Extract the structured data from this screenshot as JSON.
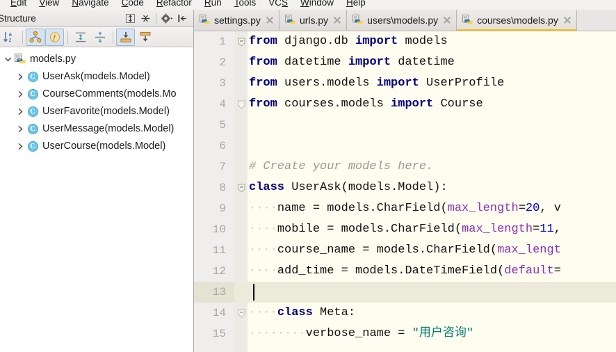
{
  "menu": {
    "items": [
      {
        "label": "Edit",
        "pre": "",
        "mnemonic": "E",
        "rest": "dit"
      },
      {
        "label": "View",
        "pre": "",
        "mnemonic": "V",
        "rest": "iew"
      },
      {
        "label": "Navigate",
        "pre": "",
        "mnemonic": "N",
        "rest": "avigate"
      },
      {
        "label": "Code",
        "pre": "",
        "mnemonic": "C",
        "rest": "ode"
      },
      {
        "label": "Refactor",
        "pre": "",
        "mnemonic": "R",
        "rest": "efactor"
      },
      {
        "label": "Run",
        "pre": "",
        "mnemonic": "R",
        "rest": "un"
      },
      {
        "label": "Tools",
        "pre": "",
        "mnemonic": "T",
        "rest": "ools"
      },
      {
        "label": "VCS",
        "pre": "VC",
        "mnemonic": "S",
        "rest": ""
      },
      {
        "label": "Window",
        "pre": "",
        "mnemonic": "W",
        "rest": "indow"
      },
      {
        "label": "Help",
        "pre": "",
        "mnemonic": "H",
        "rest": "elp"
      }
    ]
  },
  "structure": {
    "title": "Structure",
    "header_actions": [
      "expand-all-icon",
      "collapse-all-icon",
      "gear-icon",
      "hide-panel-icon"
    ],
    "toolbar_buttons": [
      {
        "name": "sort-alphabetically-icon",
        "pressed": false
      },
      {
        "name": "show-inherited-members-icon",
        "pressed": true
      },
      {
        "name": "show-fields-icon",
        "pressed": true
      },
      {
        "name": "expand-all-tree-icon",
        "pressed": false
      },
      {
        "name": "collapse-all-tree-icon",
        "pressed": false
      },
      {
        "name": "autoscroll-to-source-icon",
        "pressed": true
      },
      {
        "name": "autoscroll-from-source-icon",
        "pressed": false
      }
    ],
    "tree": [
      {
        "label": "models.py",
        "icon": "python-file-icon",
        "expanded": true,
        "depth": 0
      },
      {
        "label": "UserAsk(models.Model)",
        "icon": "class-icon",
        "expanded": false,
        "depth": 1
      },
      {
        "label": "CourseComments(models.Mo",
        "icon": "class-icon",
        "expanded": false,
        "depth": 1
      },
      {
        "label": "UserFavorite(models.Model)",
        "icon": "class-icon",
        "expanded": false,
        "depth": 1
      },
      {
        "label": "UserMessage(models.Model)",
        "icon": "class-icon",
        "expanded": false,
        "depth": 1
      },
      {
        "label": "UserCourse(models.Model)",
        "icon": "class-icon",
        "expanded": false,
        "depth": 1
      }
    ]
  },
  "editor": {
    "tabs": [
      {
        "label": "settings.py",
        "icon": "python-file-icon",
        "active": false,
        "closable": true
      },
      {
        "label": "urls.py",
        "icon": "python-file-icon",
        "active": false,
        "closable": true
      },
      {
        "label": "users\\models.py",
        "icon": "python-file-icon",
        "active": false,
        "closable": true
      },
      {
        "label": "courses\\models.py",
        "icon": "python-file-icon",
        "active": true,
        "closable": true
      }
    ],
    "active_tab_underline_color": "#f0c419",
    "current_line": 13,
    "code": [
      {
        "n": "1",
        "text": "from django.db import models",
        "fold": "expanded"
      },
      {
        "n": "2",
        "text": "from datetime import datetime",
        "fold": ""
      },
      {
        "n": "3",
        "text": "from users.models import UserProfile",
        "fold": ""
      },
      {
        "n": "4",
        "text": "from courses.models import Course",
        "fold": "end"
      },
      {
        "n": "5",
        "text": "",
        "fold": ""
      },
      {
        "n": "6",
        "text": "",
        "fold": ""
      },
      {
        "n": "7",
        "text": "# Create your models here.",
        "fold": ""
      },
      {
        "n": "8",
        "text": "class UserAsk(models.Model):",
        "fold": "expanded"
      },
      {
        "n": "9",
        "text": "    name = models.CharField(max_length=20, v",
        "fold": ""
      },
      {
        "n": "10",
        "text": "    mobile = models.CharField(max_length=11,",
        "fold": ""
      },
      {
        "n": "11",
        "text": "    course_name = models.CharField(max_lengt",
        "fold": ""
      },
      {
        "n": "12",
        "text": "    add_time = models.DateTimeField(default=",
        "fold": ""
      },
      {
        "n": "13",
        "text": "",
        "fold": ""
      },
      {
        "n": "14",
        "text": "    class Meta:",
        "fold": "expanded"
      },
      {
        "n": "15",
        "text": "        verbose_name = \"用户咨询\"",
        "fold": ""
      }
    ],
    "syntax_colors": {
      "keyword": "#000080",
      "comment": "#9a9a94",
      "kwarg": "#8c2fb5",
      "number": "#0000cf",
      "string": "#007d6e",
      "default": "#111111",
      "line_number": "#a8a8a0",
      "background": "#fffdef",
      "current_line_background": "#eceadb"
    }
  }
}
